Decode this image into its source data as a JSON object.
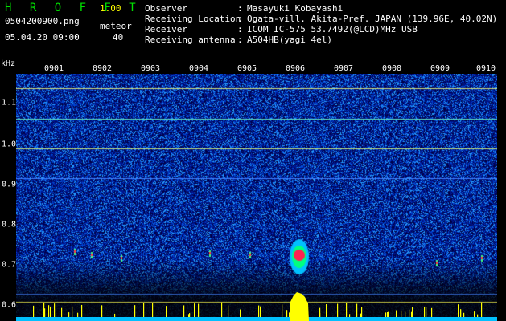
{
  "header": {
    "brand": "H R O F F T",
    "version": "1.00",
    "filename": "0504200900.png",
    "datetime": "05.04.20 09:00",
    "meteor_label": "meteor",
    "meteor_count": "40"
  },
  "info": [
    {
      "key": "Observer",
      "value": "Masayuki Kobayashi"
    },
    {
      "key": "Receiving Location",
      "value": "Ogata-vill. Akita-Pref. JAPAN (139.96E, 40.02N)"
    },
    {
      "key": "Receiver",
      "value": "ICOM IC-575 53.7492(@LCD)MHz USB"
    },
    {
      "key": "Receiving antenna",
      "value": "A504HB(yagi 4el)"
    }
  ],
  "axis": {
    "ylabel": "kHz",
    "time_ticks": [
      "0901",
      "0902",
      "0903",
      "0904",
      "0905",
      "0906",
      "0907",
      "0908",
      "0909",
      "0910"
    ],
    "freq_ticks": [
      "1.1",
      "1.0",
      "0.9",
      "0.8",
      "0.7",
      "0.6"
    ]
  },
  "colors": {
    "brand": "#00e000",
    "version": "#ffff00",
    "text": "#ffffff",
    "background": "#000000",
    "noise_floor": "#000080",
    "signal_peak": "#ff0000",
    "bar_color": "#ffff00",
    "baseline": "#00c0ff"
  }
}
